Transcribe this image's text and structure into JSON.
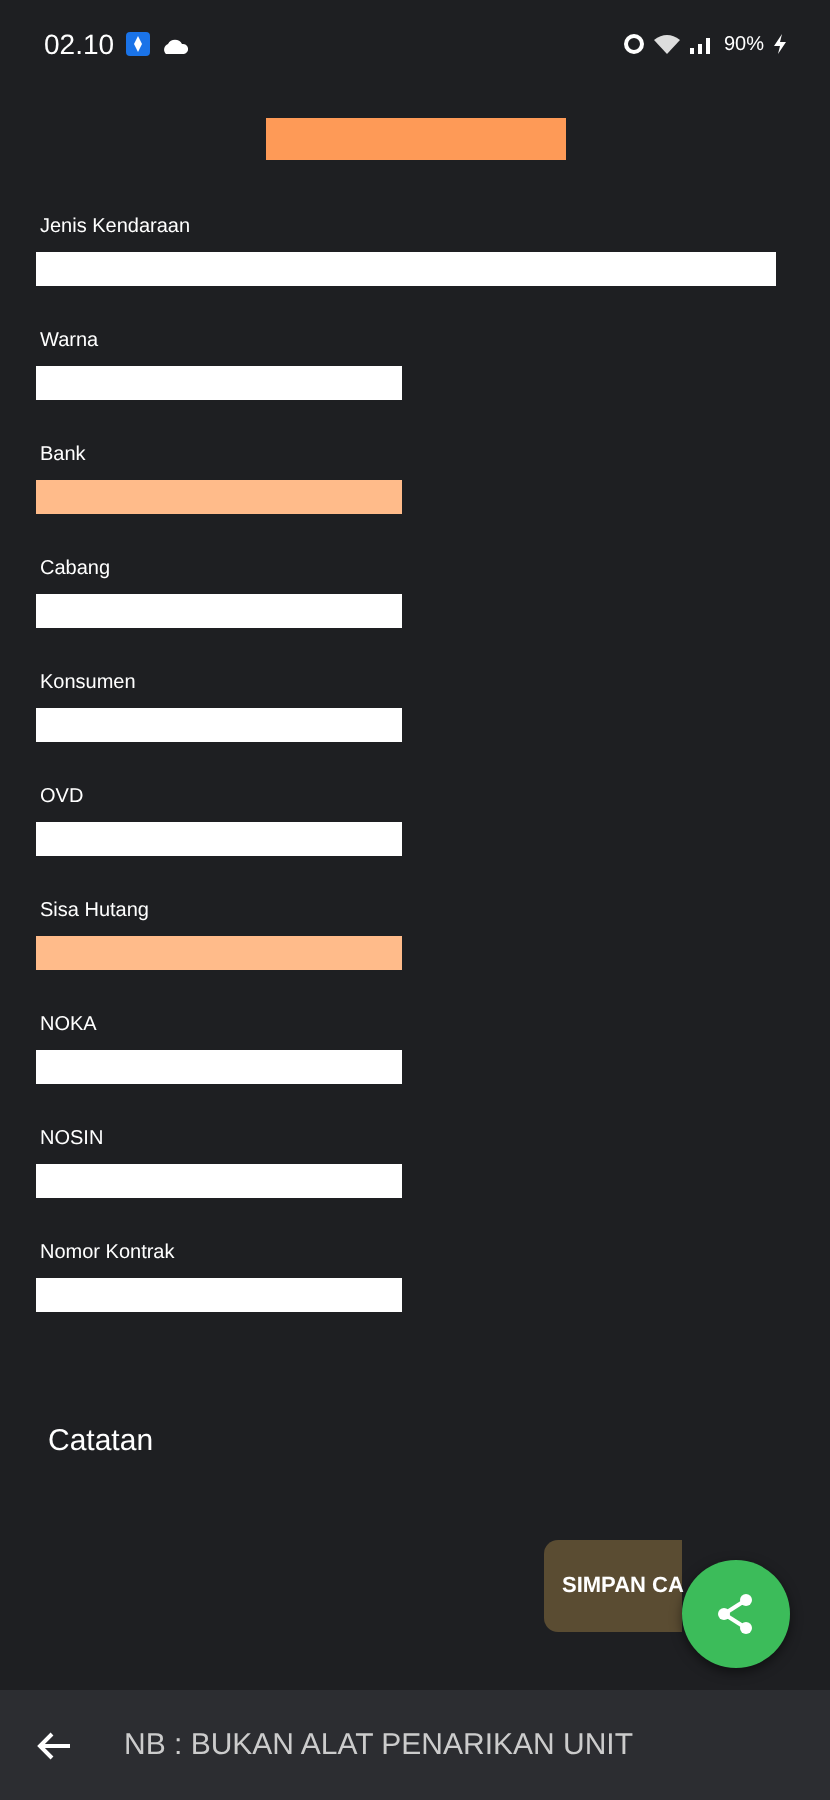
{
  "status_bar": {
    "time": "02.10",
    "battery": "90%"
  },
  "fields": [
    {
      "label": "Jenis Kendaraan",
      "wide": true,
      "highlighted": false
    },
    {
      "label": "Warna",
      "wide": false,
      "highlighted": false
    },
    {
      "label": "Bank",
      "wide": false,
      "highlighted": true
    },
    {
      "label": "Cabang",
      "wide": false,
      "highlighted": false
    },
    {
      "label": "Konsumen",
      "wide": false,
      "highlighted": false
    },
    {
      "label": "OVD",
      "wide": false,
      "highlighted": false
    },
    {
      "label": "Sisa Hutang",
      "wide": false,
      "highlighted": true
    },
    {
      "label": "NOKA",
      "wide": false,
      "highlighted": false
    },
    {
      "label": "NOSIN",
      "wide": false,
      "highlighted": false
    },
    {
      "label": "Nomor Kontrak",
      "wide": false,
      "highlighted": false
    }
  ],
  "notes_label": "Catatan",
  "save_button": "SIMPAN CA",
  "bottom_bar": {
    "text": "NB : BUKAN ALAT PENARIKAN UNIT"
  }
}
